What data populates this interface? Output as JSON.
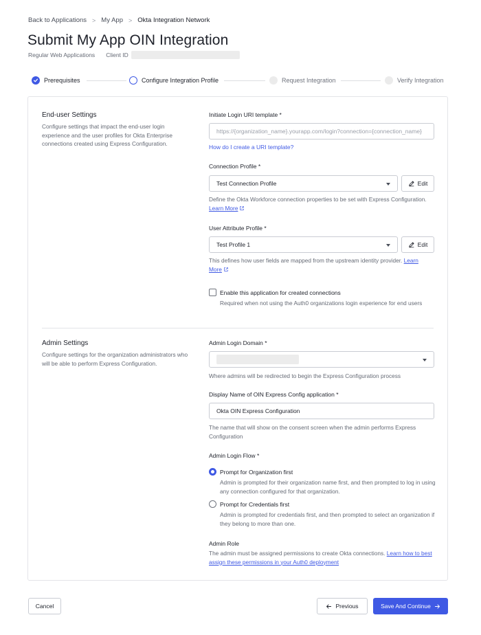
{
  "breadcrumb": {
    "items": [
      "Back to Applications",
      "My App",
      "Okta Integration Network"
    ],
    "separator": ">"
  },
  "page": {
    "title": "Submit My App OIN Integration",
    "app_type": "Regular Web Applications",
    "client_id_label": "Client ID"
  },
  "stepper": {
    "steps": [
      {
        "label": "Prerequisites",
        "state": "complete"
      },
      {
        "label": "Configure Integration Profile",
        "state": "current"
      },
      {
        "label": "Request Integration",
        "state": "upcoming"
      },
      {
        "label": "Verify Integration",
        "state": "upcoming"
      }
    ]
  },
  "end_user_settings": {
    "title": "End-user Settings",
    "description": "Configure settings that impact the end-user login experience and the user profiles for Okta Enterprise connections created using Express Configuration.",
    "login_uri": {
      "label": "Initiate Login URI template",
      "required_mark": "*",
      "placeholder": "https://{organization_name}.yourapp.com/login?connection={connection_name}",
      "help_link": "How do I create a URI template?"
    },
    "connection_profile": {
      "label": "Connection Profile",
      "required_mark": "*",
      "value": "Test Connection Profile",
      "edit_label": "Edit",
      "help": "Define the Okta Workforce connection properties to be set with Express Configuration.",
      "learn_more": "Learn More"
    },
    "user_attribute_profile": {
      "label": "User Attribute Profile",
      "required_mark": "*",
      "value": "Test Profile 1",
      "edit_label": "Edit",
      "help": "This defines how user fields are mapped from the upstream identity provider.",
      "learn_more": "Learn More"
    },
    "enable_checkbox": {
      "label": "Enable this application for created connections",
      "help": "Required when not using the Auth0 organizations login experience for end users",
      "checked": false
    }
  },
  "admin_settings": {
    "title": "Admin Settings",
    "description": "Configure settings for the organization administrators who will be able to perform Express Configuration.",
    "admin_login_domain": {
      "label": "Admin Login Domain",
      "required_mark": "*",
      "help": "Where admins will be redirected to begin the Express Configuration process"
    },
    "display_name": {
      "label": "Display Name of OIN Express Config application",
      "required_mark": "*",
      "value": "Okta OIN Express Configuration",
      "help": "The name that will show on the consent screen when the admin performs Express Configuration"
    },
    "admin_login_flow": {
      "label": "Admin Login Flow",
      "required_mark": "*",
      "options": [
        {
          "label": "Prompt for Organization first",
          "description": "Admin is prompted for their organization name first, and then prompted to log in using any connection configured for that organization.",
          "selected": true
        },
        {
          "label": "Prompt for Credentials first",
          "description": "Admin is prompted for credentials first, and then prompted to select an organization if they belong to more than one.",
          "selected": false
        }
      ]
    },
    "admin_role": {
      "title": "Admin Role",
      "text": "The admin must be assigned permissions to create Okta connections.",
      "link": "Learn how to best assign these permissions in your Auth0 deployment"
    }
  },
  "footer": {
    "cancel_label": "Cancel",
    "previous_label": "Previous",
    "save_label": "Save And Continue"
  },
  "colors": {
    "accent": "#3f59e4",
    "text": "#1e212a",
    "muted_text": "#656a75",
    "border": "#c9ccd3"
  }
}
